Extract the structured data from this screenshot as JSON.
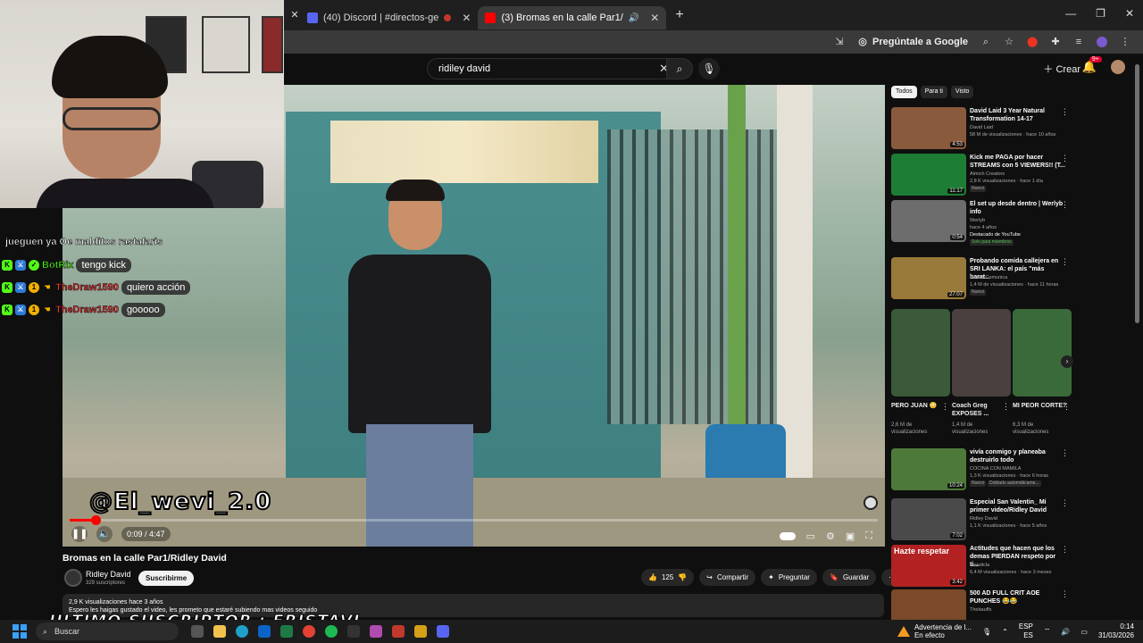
{
  "browser": {
    "tabs": [
      {
        "label": "(40) Discord | #directos-ge",
        "icon_color": "#5865f2"
      },
      {
        "label": "(3) Bromas en la calle Par1/",
        "icon_color": "#ff0000"
      }
    ],
    "toolbar": {
      "ask_google": "Pregúntale a Google"
    }
  },
  "youtube": {
    "search_value": "ridiley david",
    "create_label": "Crear",
    "notif_count": "9+",
    "video": {
      "watermark": "@El_wevi_2.0",
      "time": "0:09 / 4:47",
      "progress": 0.032,
      "title": "Bromas en la calle Par1/Ridley David",
      "channel": "Ridley David",
      "subs": "329 suscriptores",
      "subscribe": "Suscribirme",
      "likes": "125",
      "share": "Compartir",
      "ask": "Preguntar",
      "save": "Guardar",
      "desc_line1": "2,9 K visualizaciones  hace 3 años",
      "desc_line2": "Espero les haigas gustado el video, les prometo que estaré subiendo mas videos seguido"
    },
    "chips": [
      "Todos",
      "Para ti",
      "Visto"
    ],
    "recs": [
      {
        "title": "David Laid 3 Year Natural Transformation 14-17",
        "channel": "David Laid",
        "meta": "58 M de visualizaciones · hace 10 años",
        "dur": "4:53",
        "color": "#8a5a3c"
      },
      {
        "title": "Kick me PAGA por hacer STREAMS con 5 VIEWERS!! (T...",
        "channel": "Almich Creators",
        "meta": "2,8 K visualizaciones · hace 1 día",
        "dur": "11:17",
        "color": "#1e7d35",
        "badge": "Nuevo"
      },
      {
        "title": "El set up desde dentro | Werlyb info",
        "channel": "Werlyb",
        "meta": "hace 4 años",
        "dur": "0:54",
        "color": "#6d6d6d",
        "extra": "Destacado de YouTube",
        "extra2": "Solo para miembros"
      },
      {
        "title": "Probando comida callejera en SRI LANKA: el país \"más barat...",
        "channel": "Luisito Comunica",
        "meta": "1,4 M de visualizaciones · hace 11 horas",
        "dur": "27:07",
        "color": "#9a7a3a",
        "badge": "Nuevo"
      },
      {
        "title": "vivía conmigo y planeaba destruirlo todo",
        "channel": "COCINA CON MAMILA",
        "meta": "1,3 K visualizaciones · hace 6 horas",
        "dur": "10:24",
        "color": "#4d7a3a",
        "badge": "Nuevo",
        "badge2": "Doblado automáticame..."
      },
      {
        "title": "Especial San Valentin_ Mi primer video/Ridley David",
        "channel": "Ridley David",
        "meta": "1,1 K visualizaciones · hace 5 años",
        "dur": "7:02",
        "color": "#4a4a4a"
      },
      {
        "title": "Actitudes que hacen que los demas PIERDAN respeto por ti...",
        "channel": "Mendicla",
        "meta": "6,4 M visualizaciones · hace 3 meses",
        "dur": "3:42",
        "color": "#b22222",
        "thumb_text": "Hazte respetar"
      },
      {
        "title": "500 AD FULL CRIT AOE PUNCHES 😂😂",
        "channel": "Thebauffs",
        "meta": "",
        "dur": "",
        "color": "#7a4a2a"
      }
    ],
    "shorts": [
      {
        "title": "PERO JUAN 😳",
        "meta": "2,6 M de visualizaciones",
        "color": "#3a5a3a"
      },
      {
        "title": "Coach Greg EXPOSES ...",
        "meta": "1,4 M de visualizaciones",
        "color": "#4a4040"
      },
      {
        "title": "MI PEOR CORTE?",
        "meta": "6,3 M de visualizaciones",
        "color": "#3a6a3a"
      }
    ]
  },
  "stream": {
    "chat_top": "jueguen ya Oe malditos rastafaris",
    "chat": [
      {
        "user": "BotRix",
        "msg": "tengo kick",
        "color": "#53fc18"
      },
      {
        "user": "TheDraw1590",
        "msg": "quiero acción",
        "color": "#ff3b3b"
      },
      {
        "user": "TheDraw1590",
        "msg": "gooooo",
        "color": "#ff3b3b"
      }
    ],
    "overlay": "ULTIMO SUSCRIPTOR : FRISTAVL"
  },
  "taskbar": {
    "search": "Buscar",
    "warning_title": "Advertencia de l...",
    "warning_sub": "En efecto",
    "lang": "ESP",
    "lang2": "ES",
    "time": "0:14",
    "date": "31/03/2026"
  }
}
